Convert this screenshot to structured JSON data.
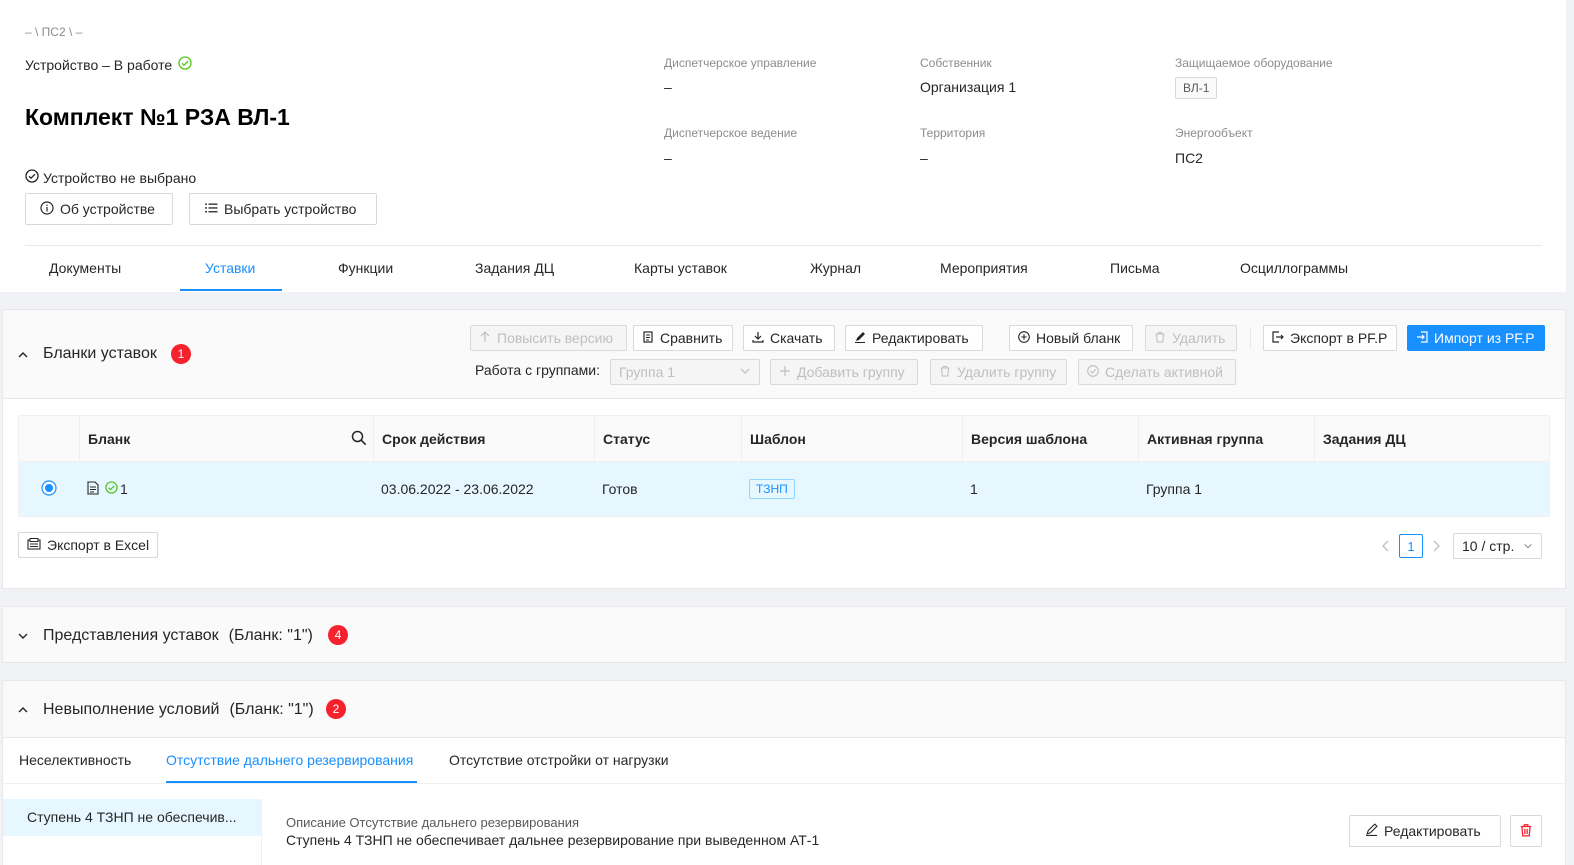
{
  "header": {
    "breadcrumb": "– \\ ПС2 \\ –",
    "device_status": "Устройство – В работе",
    "title": "Комплект №1 РЗА ВЛ-1",
    "device_selected": "Устройство не выбрано",
    "about_button": "Об устройстве",
    "choose_button": "Выбрать устройство",
    "fields": {
      "dispatch_control_label": "Диспетчерское управление",
      "dispatch_control_value": "–",
      "owner_label": "Собственник",
      "owner_value": "Организация 1",
      "protected_label": "Защищаемое оборудование",
      "protected_value": "ВЛ-1",
      "dispatch_lead_label": "Диспетчерское ведение",
      "dispatch_lead_value": "–",
      "territory_label": "Территория",
      "territory_value": "–",
      "energy_label": "Энергообъект",
      "energy_value": "ПС2"
    }
  },
  "tabs": [
    "Документы",
    "Уставки",
    "Функции",
    "Задания ДЦ",
    "Карты уставок",
    "Журнал",
    "Мероприятия",
    "Письма",
    "Осциллограммы"
  ],
  "blanks": {
    "title": "Бланки уставок",
    "badge": "1",
    "toolbar": {
      "raise_version": "Повысить версию",
      "compare": "Сравнить",
      "download": "Скачать",
      "edit": "Редактировать",
      "new_blank": "Новый бланк",
      "delete": "Удалить",
      "export_pfp": "Экспорт в PF.P",
      "import_pfp": "Импорт из PF.P",
      "groups_label": "Работа с группами:",
      "group_select": "Группа 1",
      "add_group": "Добавить группу",
      "delete_group": "Удалить группу",
      "make_active": "Сделать активной"
    },
    "columns": [
      "Бланк",
      "Срок действия",
      "Статус",
      "Шаблон",
      "Версия шаблона",
      "Активная группа",
      "Задания ДЦ"
    ],
    "row": {
      "blank": "1",
      "period": "03.06.2022 - 23.06.2022",
      "status": "Готов",
      "template": "ТЗНП",
      "template_version": "1",
      "active_group": "Группа 1",
      "tasks": ""
    },
    "export_excel": "Экспорт в Excel",
    "pagination": {
      "page": "1",
      "page_size": "10 / стр."
    }
  },
  "views": {
    "title": "Представления уставок",
    "subtitle": "(Бланк: \"1\")",
    "badge": "4"
  },
  "violations": {
    "title": "Невыполнение условий",
    "subtitle": "(Бланк: \"1\")",
    "badge": "2",
    "tabs": [
      "Неселективность",
      "Отсутствие дальнего резервирования",
      "Отсутствие отстройки от нагрузки"
    ],
    "list_item": "Ступень 4 ТЗНП не обеспечив...",
    "desc_label": "Описание Отсутствие дальнего резервирования",
    "desc_text": "Ступень 4 ТЗНП не обеспечивает дальнее резервирование при выведенном АТ-1",
    "edit_button": "Редактировать"
  }
}
